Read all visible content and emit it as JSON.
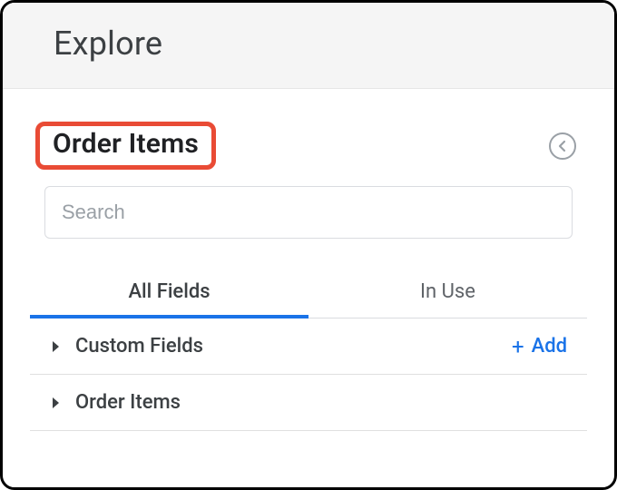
{
  "header": {
    "title": "Explore"
  },
  "panel": {
    "title": "Order Items"
  },
  "search": {
    "placeholder": "Search"
  },
  "tabs": {
    "all_fields": "All Fields",
    "in_use": "In Use"
  },
  "sections": {
    "custom_fields": "Custom Fields",
    "order_items": "Order Items"
  },
  "actions": {
    "add": "Add"
  },
  "colors": {
    "accent": "#1a73e8",
    "highlight": "#e94b35"
  }
}
